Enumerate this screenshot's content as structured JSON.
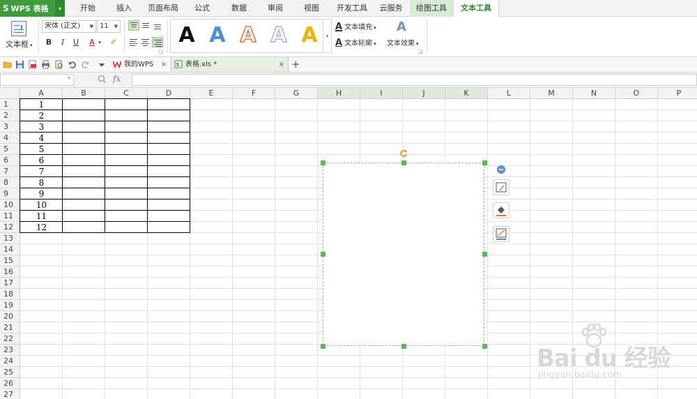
{
  "app": {
    "logo": "S",
    "name": "WPS 表格"
  },
  "menu": {
    "tabs": [
      "开始",
      "插入",
      "页面布局",
      "公式",
      "数据",
      "审阅",
      "视图",
      "开发工具",
      "云服务",
      "绘图工具",
      "文本工具"
    ],
    "active": "文本工具",
    "contextual": "绘图工具"
  },
  "ribbon": {
    "textbox_label": "文本框",
    "font_name": "宋体 (正文)",
    "font_size": "11",
    "bold": "B",
    "italic": "I",
    "underline": "U",
    "font_color_glyph": "A",
    "styles": [
      "A",
      "A",
      "A",
      "A",
      "A"
    ],
    "style_colors": [
      "#111111",
      "#4a8fd8",
      "#e8733a",
      "#9fb7d8",
      "#f0b400"
    ],
    "text_fill": "文本填充",
    "text_outline": "文本轮廓",
    "text_effect": "文本效果",
    "outline_glyph": "A",
    "effect_glyph": "A"
  },
  "doc_tabs": [
    {
      "label": "我的WPS",
      "close": "×"
    },
    {
      "label": "表格.xls *",
      "close": "×"
    }
  ],
  "new_tab": "+",
  "formula_bar": {
    "name_box": "",
    "fx": "fx",
    "value": ""
  },
  "sheet": {
    "columns": [
      "A",
      "B",
      "C",
      "D",
      "E",
      "F",
      "G",
      "H",
      "I",
      "J",
      "K",
      "L",
      "M",
      "N",
      "O",
      "P"
    ],
    "rows": [
      "1",
      "2",
      "3",
      "4",
      "5",
      "6",
      "7",
      "8",
      "9",
      "10",
      "11",
      "12",
      "13",
      "14",
      "15",
      "16",
      "17",
      "18",
      "19",
      "20",
      "21",
      "22",
      "23",
      "24",
      "25",
      "26",
      "27"
    ],
    "colA_values": [
      "1",
      "2",
      "3",
      "4",
      "5",
      "6",
      "7",
      "8",
      "9",
      "10",
      "11",
      "12"
    ]
  },
  "watermark": {
    "brand": "Bai du 经验",
    "url": "jingyan.baidu.com"
  }
}
